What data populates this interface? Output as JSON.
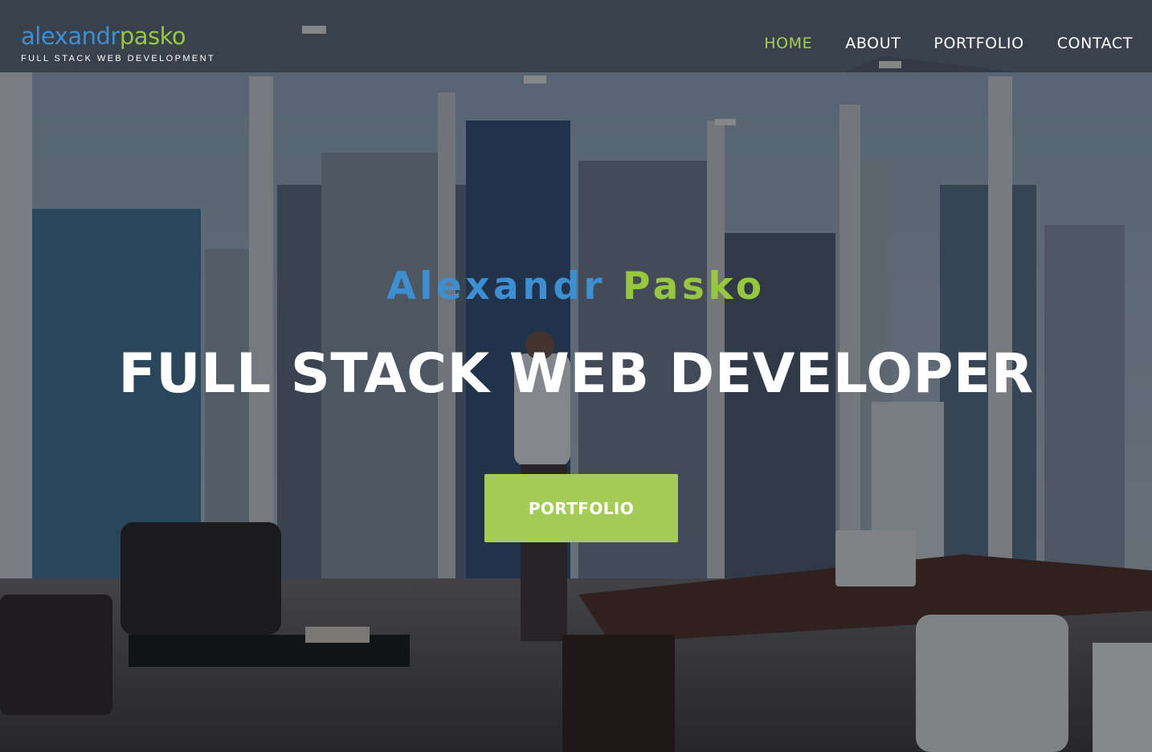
{
  "logo": {
    "word_first": "alexandr",
    "word_second": "pasko",
    "tagline": "FULL STACK WEB DEVELOPMENT"
  },
  "nav": {
    "items": [
      {
        "label": "HOME",
        "active": true
      },
      {
        "label": "ABOUT",
        "active": false
      },
      {
        "label": "PORTFOLIO",
        "active": false
      },
      {
        "label": "CONTACT",
        "active": false
      }
    ]
  },
  "hero": {
    "first_name": "Alexandr",
    "last_name": "Pasko",
    "title": "FULL STACK WEB DEVELOPER",
    "cta_label": "PORTFOLIO"
  },
  "colors": {
    "blue": "#3d8fd1",
    "green": "#97c73e",
    "button": "#a3cd55",
    "nav_active": "#a5cf54"
  }
}
